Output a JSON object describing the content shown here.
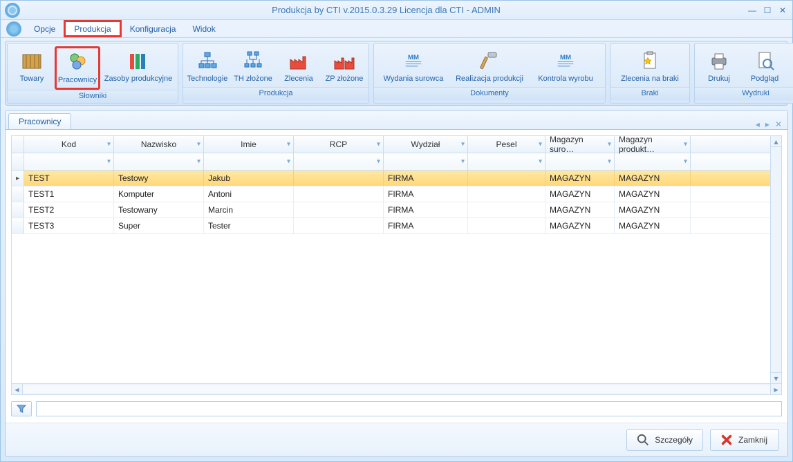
{
  "title": "Produkcja by CTI v.2015.0.3.29 Licencja dla CTI - ADMIN",
  "menu": {
    "opcje": "Opcje",
    "produkcja": "Produkcja",
    "konfiguracja": "Konfiguracja",
    "widok": "Widok"
  },
  "ribbon": {
    "groups": {
      "slowniki": {
        "label": "Słowniki",
        "towary": "Towary",
        "pracownicy": "Pracownicy",
        "zasoby": "Zasoby produkcyjne"
      },
      "produkcja": {
        "label": "Produkcja",
        "technologie": "Technologie",
        "th": "TH złożone",
        "zlecenia": "Zlecenia",
        "zp": "ZP złożone"
      },
      "dokumenty": {
        "label": "Dokumenty",
        "wydania": "Wydania surowca",
        "realizacja": "Realizacja produkcji",
        "kontrola": "Kontrola wyrobu"
      },
      "braki": {
        "label": "Braki",
        "zlecenia_braki": "Zlecenia na braki"
      },
      "wydruki": {
        "label": "Wydruki",
        "drukuj": "Drukuj",
        "podglad": "Podgląd"
      }
    }
  },
  "tab": {
    "pracownicy": "Pracownicy"
  },
  "columns": {
    "kod": "Kod",
    "nazwisko": "Nazwisko",
    "imie": "Imie",
    "rcp": "RCP",
    "wydzial": "Wydział",
    "pesel": "Pesel",
    "magsuro": "Magazyn suro…",
    "magprod": "Magazyn produkt…"
  },
  "rows": [
    {
      "kod": "TEST",
      "nazwisko": "Testowy",
      "imie": "Jakub",
      "rcp": "",
      "wydzial": "FIRMA",
      "pesel": "",
      "magsuro": "MAGAZYN",
      "magprod": "MAGAZYN"
    },
    {
      "kod": "TEST1",
      "nazwisko": "Komputer",
      "imie": "Antoni",
      "rcp": "",
      "wydzial": "FIRMA",
      "pesel": "",
      "magsuro": "MAGAZYN",
      "magprod": "MAGAZYN"
    },
    {
      "kod": "TEST2",
      "nazwisko": "Testowany",
      "imie": "Marcin",
      "rcp": "",
      "wydzial": "FIRMA",
      "pesel": "",
      "magsuro": "MAGAZYN",
      "magprod": "MAGAZYN"
    },
    {
      "kod": "TEST3",
      "nazwisko": "Super",
      "imie": "Tester",
      "rcp": "",
      "wydzial": "FIRMA",
      "pesel": "",
      "magsuro": "MAGAZYN",
      "magprod": "MAGAZYN"
    }
  ],
  "buttons": {
    "szczegoly": "Szczegóły",
    "zamknij": "Zamknij"
  }
}
